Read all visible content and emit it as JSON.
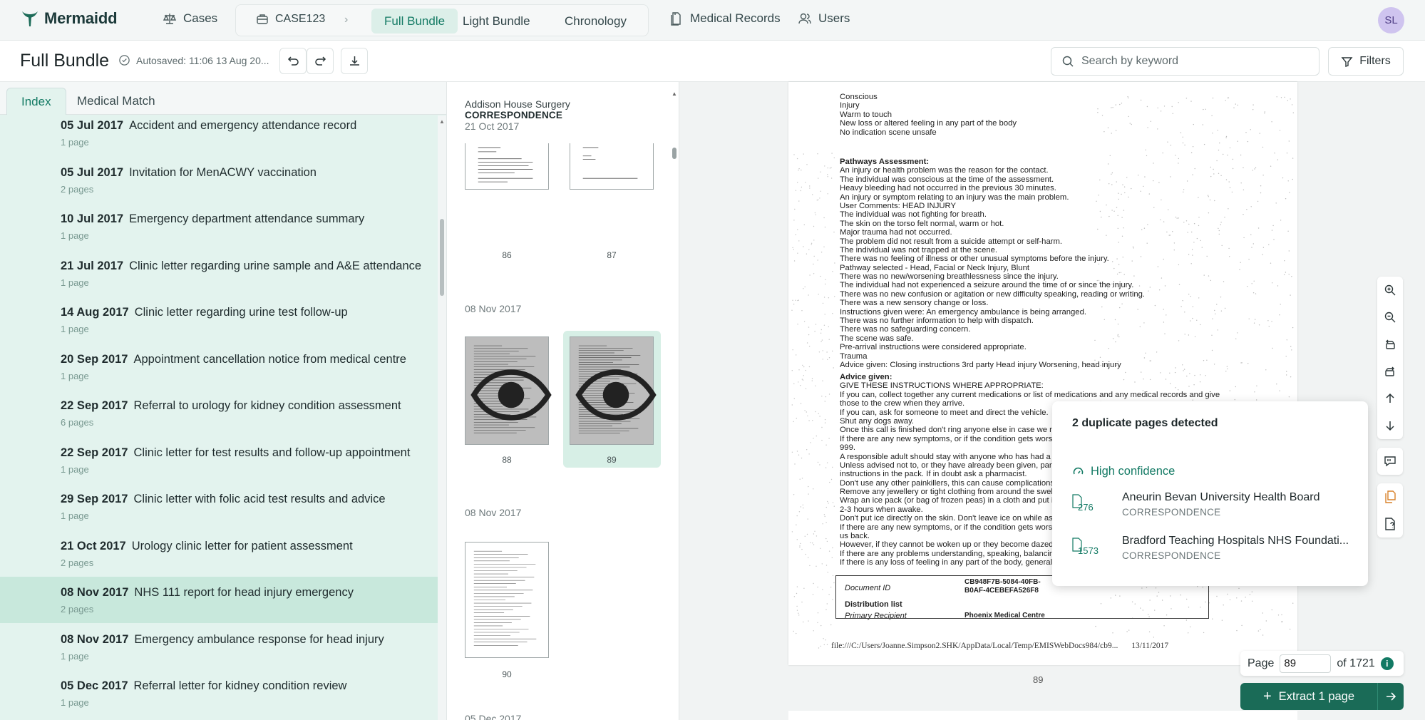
{
  "app": {
    "name": "Mermaidd",
    "avatar_initials": "SL"
  },
  "nav": {
    "cases": "Cases",
    "case_id": "CASE123",
    "bundle_tabs": [
      "Full Bundle",
      "Light Bundle",
      "Chronology"
    ],
    "medical_records": "Medical Records",
    "users": "Users"
  },
  "header": {
    "title": "Full Bundle",
    "autosave": "Autosaved: 11:06 13 Aug 20...",
    "search_placeholder": "Search by keyword",
    "filters": "Filters"
  },
  "left_tabs": [
    "Index",
    "Medical Match"
  ],
  "index_items": [
    {
      "date": "05 Jul 2017",
      "title": "Accident and emergency attendance record",
      "pages": "1 page"
    },
    {
      "date": "05 Jul 2017",
      "title": "Invitation for MenACWY vaccination",
      "pages": "2 pages"
    },
    {
      "date": "10 Jul 2017",
      "title": "Emergency department attendance summary",
      "pages": "1 page"
    },
    {
      "date": "21 Jul 2017",
      "title": "Clinic letter regarding urine sample and A&E attendance",
      "pages": "1 page"
    },
    {
      "date": "14 Aug 2017",
      "title": "Clinic letter regarding urine test follow-up",
      "pages": "1 page"
    },
    {
      "date": "20 Sep 2017",
      "title": "Appointment cancellation notice from medical centre",
      "pages": "1 page"
    },
    {
      "date": "22 Sep 2017",
      "title": "Referral to urology for kidney condition assessment",
      "pages": "6 pages"
    },
    {
      "date": "22 Sep 2017",
      "title": "Clinic letter for test results and follow-up appointment",
      "pages": "1 page"
    },
    {
      "date": "29 Sep 2017",
      "title": "Clinic letter with folic acid test results and advice",
      "pages": "1 page"
    },
    {
      "date": "21 Oct 2017",
      "title": "Urology clinic letter for patient assessment",
      "pages": "2 pages"
    },
    {
      "date": "08 Nov 2017",
      "title": "NHS 111 report for head injury emergency",
      "pages": "2 pages",
      "selected": true
    },
    {
      "date": "08 Nov 2017",
      "title": "Emergency ambulance response for head injury",
      "pages": "1 page"
    },
    {
      "date": "05 Dec 2017",
      "title": "Referral letter for kidney condition review",
      "pages": "1 page"
    }
  ],
  "thumb_groups": {
    "g1": {
      "org": "Addison House Surgery",
      "category": "CORRESPONDENCE",
      "date": "21 Oct 2017"
    },
    "g2": {
      "date": "08 Nov 2017"
    },
    "g3": {
      "date": "08 Nov 2017"
    },
    "g4": {
      "date": "05 Dec 2017"
    }
  },
  "thumb_pages": [
    "86",
    "87",
    "88",
    "89",
    "90"
  ],
  "document": {
    "lines_top": [
      "Conscious",
      "Injury",
      "Warm to touch",
      "New loss or altered feeling in any part of the body",
      "No indication scene unsafe"
    ],
    "pathways_heading": "Pathways Assessment:",
    "pathways_lines": [
      "An injury or health problem was the reason for the contact.",
      "The individual was conscious at the time of the assessment.",
      "Heavy bleeding had not occurred in the previous 30 minutes.",
      "An injury or symptom relating to an injury was the main problem.",
      "User Comments: HEAD INJURY",
      "The individual was not fighting for breath.",
      "The skin on the torso felt normal, warm or hot.",
      "Major trauma had not occurred.",
      "The problem did not result from a suicide attempt or self-harm.",
      "The individual was not trapped at the scene.",
      "There was no feeling of illness or other unusual symptoms before the injury.",
      "Pathway selected - Head, Facial or Neck Injury, Blunt",
      "There was no new/worsening breathlessness since the injury.",
      "The individual had not experienced a seizure around the time of or since the injury.",
      "There was no new confusion or agitation or new difficulty speaking, reading or writing.",
      "There was a new sensory change or loss.",
      "Instructions given were: An emergency ambulance is being arranged.",
      "There was no further information to help with dispatch.",
      "There was no safeguarding concern.",
      "The scene was safe.",
      "Pre-arrival instructions were considered appropriate.",
      "Trauma",
      "Advice given: Closing instructions 3rd party Head injury Worsening, head injury"
    ],
    "advice_heading": "Advice given:",
    "advice_lines": [
      "GIVE THESE INSTRUCTIONS WHERE APPROPRIATE:",
      "If you can, collect together any current medications or list of medications and any medical records and give",
      "those to the crew when they arrive.",
      "If you can, ask for someone to meet and direct the vehicle.",
      "Shut any dogs away.",
      "Once this call is finished don't ring anyone else in case we nee",
      "If there are any new symptoms, or if the condition gets worse, c",
      "999.",
      "A responsible adult should stay with anyone who has had a hea",
      "Unless advised not to, or they have already been given, parace",
      "instructions in the pack. If in doubt ask a pharmacist.",
      "Don't use any other painkillers, this can cause complications fo",
      "Remove any jewellery or tight clothing from around the swelling",
      "Wrap an ice pack (or bag of frozen peas) in a cloth and put it o",
      "2-3 hours when awake.",
      "Don't put ice directly on the skin. Don't leave ice on while aslee",
      "If there are any new symptoms, or if the condition gets worse, c",
      "us back.",
      "However, if they cannot be woken up or they become dazed, g",
      "If there are any problems understanding, speaking, balancing o",
      "If there is any loss of feeling in any part of the body, general w"
    ],
    "docid_label": "Document ID",
    "docid_value_1": "CB948F7B-5084-40FB-",
    "docid_value_2": "B0AF-4CEBEFA526F8",
    "distribution_label": "Distribution list",
    "primary_label": "Primary Recipient",
    "primary_value": "Phoenix Medical Centre",
    "footer_path": "file:///C:/Users/Joanne.Simpson2.SHK/AppData/Local/Temp/EMISWebDocs984/cb9...",
    "footer_date": "13/11/2017",
    "page_number": "89"
  },
  "duplicate_popup": {
    "title": "2 duplicate pages detected",
    "confidence": "High confidence",
    "items": [
      {
        "page": "276",
        "org": "Aneurin Bevan University Health Board",
        "category": "CORRESPONDENCE"
      },
      {
        "page": "1573",
        "org": "Bradford Teaching Hospitals NHS Foundati...",
        "category": "CORRESPONDENCE"
      }
    ]
  },
  "page_nav": {
    "label": "Page",
    "value": "89",
    "of": "of 1721",
    "info": "i"
  },
  "extract_button": "Extract 1 page",
  "colors": {
    "accent": "#137a64",
    "selection": "#c8e8dc",
    "list_bg": "#e3f3ee",
    "extract": "#1a6b57"
  }
}
